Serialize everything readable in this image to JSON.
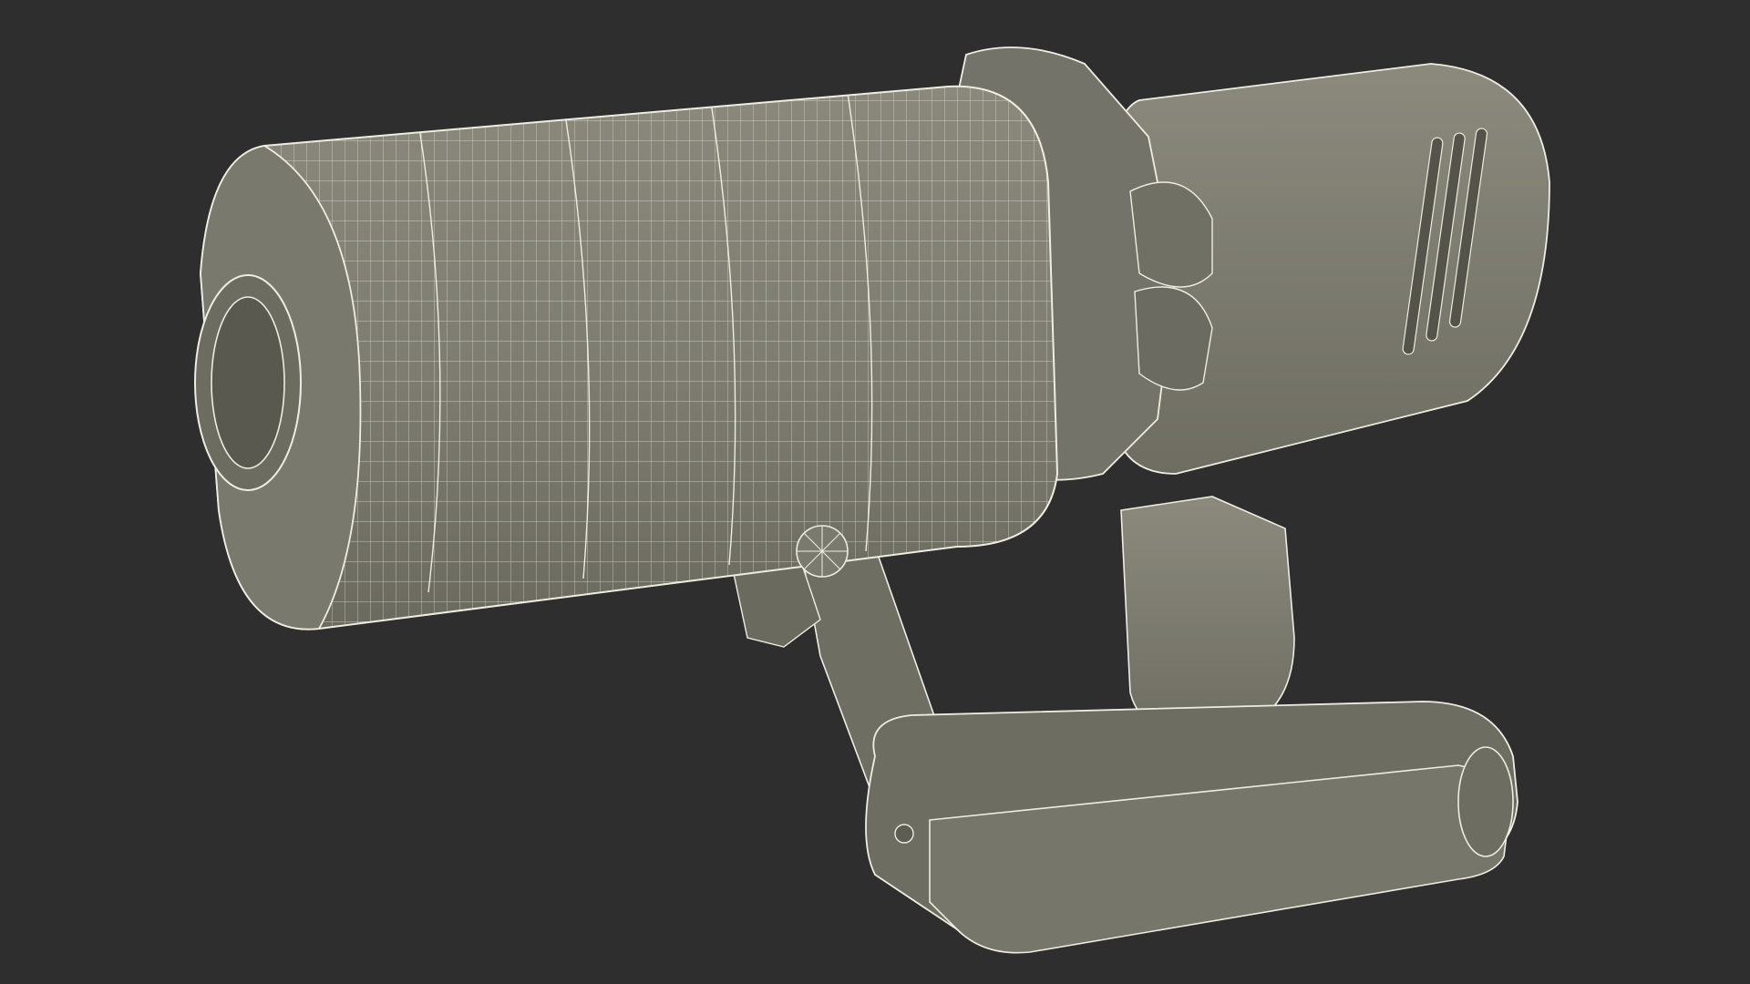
{
  "scene": {
    "subject": "wireframe-handheld-vacuum",
    "background_color": "#2e2e2e",
    "surface_color": "#7d7c70",
    "surface_dark_color": "#65645a",
    "wire_color": "#eeeee0"
  }
}
